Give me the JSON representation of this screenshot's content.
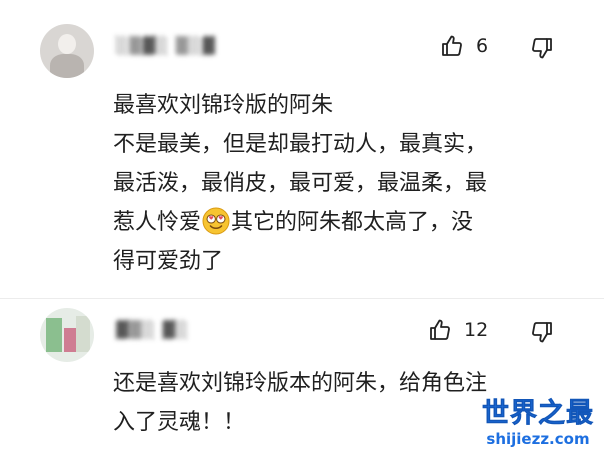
{
  "comments": [
    {
      "username": "░▒▓░ ▒░▓",
      "like_count": "6",
      "lines": [
        "最喜欢刘锦玲版的阿朱",
        "不是最美，但是却最打动人，最真实，",
        "最活泼，最俏皮，最可爱，最温柔，最",
        "惹人怜爱",
        "其它的阿朱都太高了，没",
        "得可爱劲了"
      ],
      "emoji": "smiling-face-with-heart-eyes-icon"
    },
    {
      "username": "▓▒░ ▓░",
      "like_count": "12",
      "lines": [
        "还是喜欢刘锦玲版本的阿朱，给角色注",
        "入了灵魂！！"
      ]
    }
  ],
  "icons": {
    "like": "thumbs-up-icon",
    "dislike": "thumbs-down-icon"
  },
  "watermark": {
    "title": "世界之最",
    "url": "shijiezz.com"
  },
  "colors": {
    "text": "#1f1f1f",
    "watermark": "#1d6fe0"
  }
}
